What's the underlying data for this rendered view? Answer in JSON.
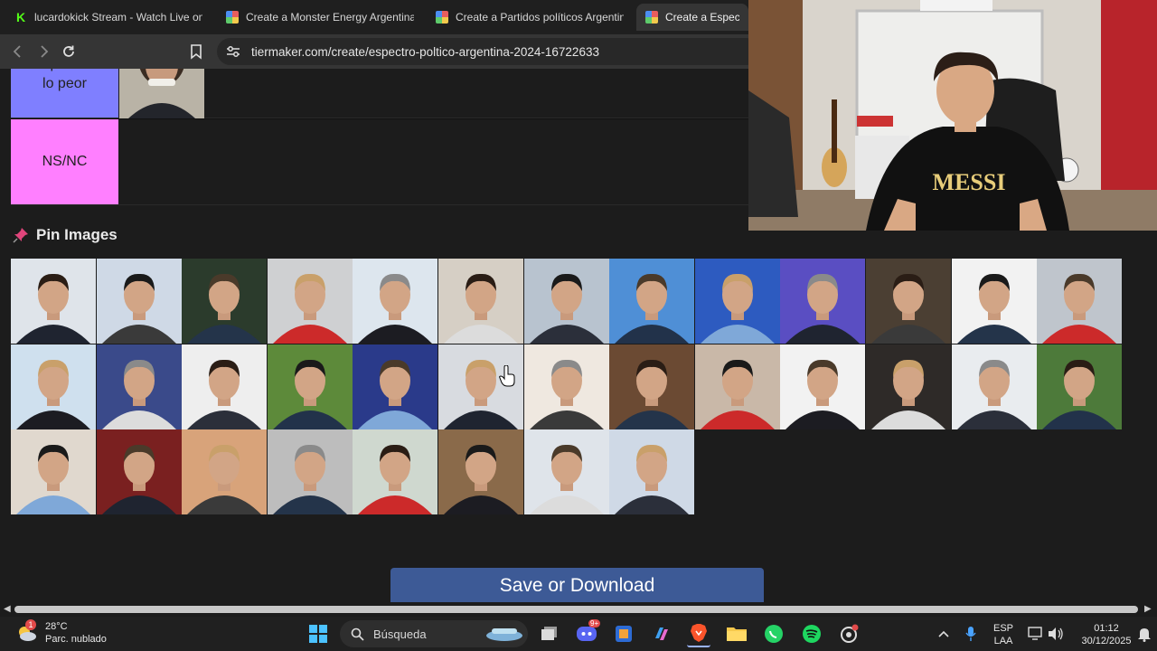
{
  "browser": {
    "tabs": [
      {
        "label": "lucardokick Stream - Watch Live on K",
        "icon": "kick-icon",
        "active": false
      },
      {
        "label": "Create a Monster Energy Argentina T",
        "icon": "tiermaker-icon",
        "active": false
      },
      {
        "label": "Create a Partidos políticos Argentina",
        "icon": "tiermaker-icon",
        "active": false
      },
      {
        "label": "Create a Espectro p",
        "icon": "tiermaker-icon",
        "active": true
      }
    ],
    "url": "tiermaker.com/create/espectro-poltico-argentina-2024-16722633"
  },
  "tiers": [
    {
      "label": "Lo peor de lo peor",
      "color": "#7f7fff",
      "items": 1
    },
    {
      "label": "NS/NC",
      "color": "#ff7fff",
      "items": 0
    }
  ],
  "pin_section": {
    "title": "Pin Images",
    "image_count": 34
  },
  "save_button": {
    "label": "Save or Download"
  },
  "webcam_shirt_text": "MESSI",
  "taskbar": {
    "weather_temp": "28°C",
    "weather_desc": "Parc. nublado",
    "weather_badge": "1",
    "search_placeholder": "Búsqueda",
    "discord_badge": "9+",
    "lang_top": "ESP",
    "lang_bottom": "LAA",
    "time": "01:12",
    "date": "30/12/2025"
  }
}
